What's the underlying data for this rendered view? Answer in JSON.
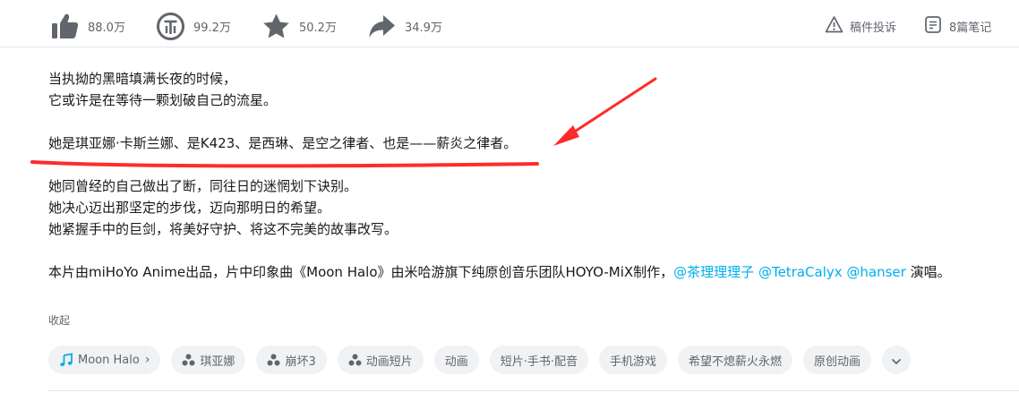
{
  "toolbar": {
    "like_count": "88.0万",
    "coin_count": "99.2万",
    "favorite_count": "50.2万",
    "share_count": "34.9万",
    "report_label": "稿件投诉",
    "notes_label": "8篇笔记"
  },
  "description": {
    "lines": [
      "当执拗的黑暗填满长夜的时候，",
      "它或许是在等待一颗划破自己的流星。",
      "",
      "她是琪亚娜·卡斯兰娜、是K423、是西琳、是空之律者、也是——薪炎之律者。",
      "",
      "她同曾经的自己做出了断，同往日的迷惘划下诀别。",
      "她决心迈出那坚定的步伐，迈向那明日的希望。",
      "她紧握手中的巨剑，将美好守护、将这不完美的故事改写。",
      ""
    ],
    "credit_prefix": "本片由miHoYo Anime出品，片中印象曲《Moon Halo》由米哈游旗下纯原创音乐团队HOYO-MiX制作，",
    "mentions": [
      "@茶理理理子",
      "@TetraCalyx",
      "@hanser"
    ],
    "credit_suffix": "演唱。",
    "collapse_label": "收起"
  },
  "tags": {
    "music_tag": "Moon Halo",
    "topic_tags": [
      "琪亚娜",
      "崩坏3",
      "动画短片"
    ],
    "plain_tags": [
      "动画",
      "短片·手书·配音",
      "手机游戏",
      "希望不熄薪火永燃",
      "原创动画"
    ]
  },
  "colors": {
    "accent": "#00aeec",
    "annotation": "#ff2b2b",
    "icon": "#61666d"
  },
  "icons": {
    "like": "thumbs-up-icon",
    "coin": "coin-icon",
    "favorite": "star-icon",
    "share": "share-arrow-icon",
    "report": "warning-triangle-icon",
    "notes": "notes-icon",
    "music": "music-note-icon",
    "topic": "topic-dots-icon",
    "more": "chevron-down-icon"
  }
}
